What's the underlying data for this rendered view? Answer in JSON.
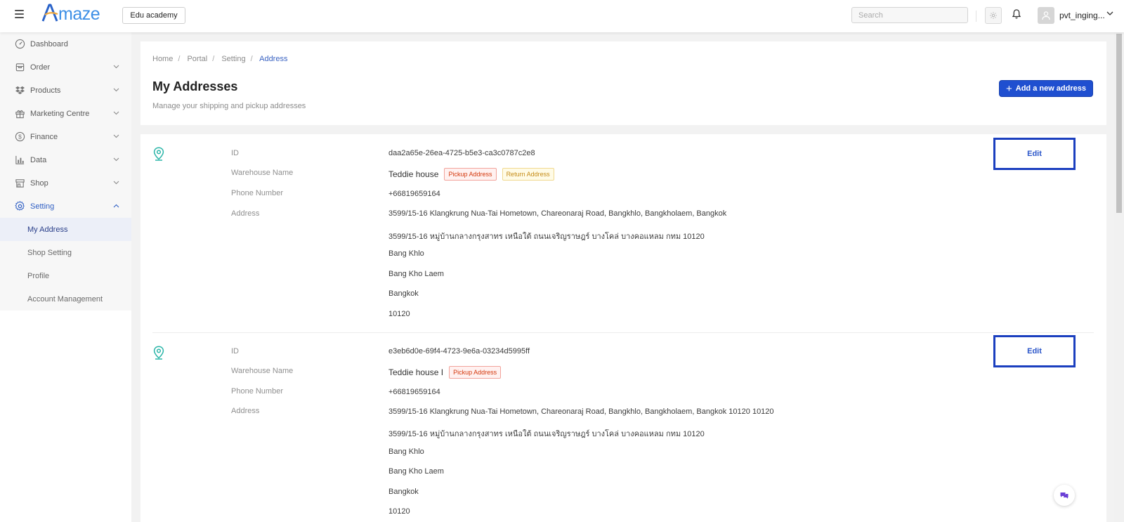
{
  "app": {
    "logo_text": "maze",
    "shop_selector": "Edu academy"
  },
  "header": {
    "search_placeholder": "Search",
    "username": "pvt_inging..."
  },
  "sidebar": {
    "items": [
      {
        "label": "Dashboard",
        "icon": "dashboard-icon"
      },
      {
        "label": "Order",
        "icon": "box-icon"
      },
      {
        "label": "Products",
        "icon": "dropbox-icon"
      },
      {
        "label": "Marketing Centre",
        "icon": "gift-icon"
      },
      {
        "label": "Finance",
        "icon": "dollar-icon"
      },
      {
        "label": "Data",
        "icon": "bar-chart-icon"
      },
      {
        "label": "Shop",
        "icon": "store-icon"
      },
      {
        "label": "Setting",
        "icon": "gear-icon"
      }
    ],
    "sub_items": [
      {
        "label": "My Address"
      },
      {
        "label": "Shop Setting"
      },
      {
        "label": "Profile"
      },
      {
        "label": "Account Management"
      }
    ]
  },
  "breadcrumb": [
    "Home",
    "Portal",
    "Setting",
    "Address"
  ],
  "page": {
    "title": "My Addresses",
    "subtitle": "Manage your shipping and pickup addresses",
    "add_button": "Add a new address"
  },
  "labels": {
    "id": "ID",
    "warehouse": "Warehouse Name",
    "phone": "Phone Number",
    "address": "Address",
    "edit": "Edit"
  },
  "tags": {
    "pickup": "Pickup Address",
    "return": "Return Address"
  },
  "addresses": [
    {
      "id": "daa2a65e-26ea-4725-b5e3-ca3c0787c2e8",
      "warehouse": "Teddie house",
      "phone": "+66819659164",
      "lines": [
        "3599/15-16 Klangkrung Nua-Tai Hometown, Chareonaraj Road, Bangkhlo, Bangkholaem, Bangkok",
        "3599/15-16 หมู่บ้านกลางกรุงสาทร เหนือใต้ ถนนเจริญราษฎร์ บางโคล่ บางคอแหลม กทม 10120",
        "Bang Khlo",
        "Bang Kho Laem",
        "Bangkok",
        "10120"
      ]
    },
    {
      "id": "e3eb6d0e-69f4-4723-9e6a-03234d5995ff",
      "warehouse": "Teddie house I",
      "phone": "+66819659164",
      "lines": [
        "3599/15-16 Klangkrung Nua-Tai Hometown, Chareonaraj Road, Bangkhlo, Bangkholaem, Bangkok 10120 10120",
        "3599/15-16 หมู่บ้านกลางกรุงสาทร เหนือใต้ ถนนเจริญราษฎร์ บางโคล่ บางคอแหลม กทม 10120",
        "Bang Khlo",
        "Bang Kho Laem",
        "Bangkok",
        "10120"
      ]
    }
  ],
  "colors": {
    "accent": "#1f4fd0",
    "pin": "#2bb5a8",
    "active_nav": "#2f5fc4"
  }
}
